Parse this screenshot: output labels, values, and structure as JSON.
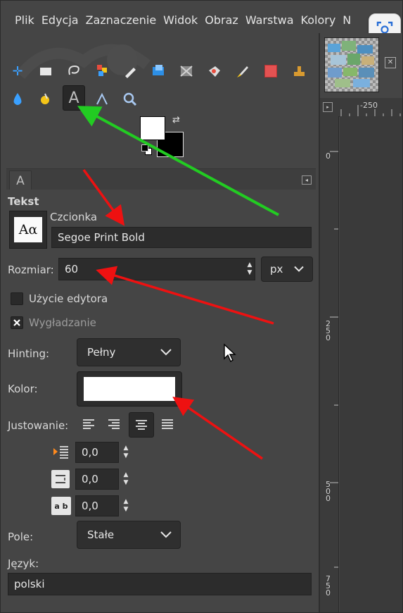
{
  "menubar": {
    "items": [
      "Plik",
      "Edycja",
      "Zaznaczenie",
      "Widok",
      "Obraz",
      "Warstwa",
      "Kolory",
      "N"
    ]
  },
  "toolbox": {
    "active_tool": "text-tool",
    "tools_row1": [
      "move-icon",
      "rect-select-icon",
      "lasso-icon",
      "fuzzy-select-icon",
      "pen-icon",
      "crop-icon",
      "transform-icon",
      "warp-icon",
      "paintbrush-icon",
      "eraser-icon",
      "clone-icon"
    ],
    "tools_row2": [
      "dodge-burn-icon",
      "paths-icon",
      "text-icon",
      "measure-icon",
      "zoom-icon"
    ]
  },
  "colors": {
    "foreground": "#ffffff",
    "background": "#000000"
  },
  "tool_options": {
    "title": "Tekst",
    "font_label": "Czcionka",
    "font_preview": "Aα",
    "font_value": "Segoe Print Bold",
    "size_label": "Rozmiar:",
    "size_value": "60",
    "size_unit": "px",
    "use_editor_label": "Użycie edytora",
    "antialias_label": "Wygładzanie",
    "hinting_label": "Hinting:",
    "hinting_value": "Pełny",
    "color_label": "Kolor:",
    "color_value": "#ffffff",
    "justify_label": "Justowanie:",
    "indent_value": "0,0",
    "line_spacing_value": "0,0",
    "letter_spacing_value": "0,0",
    "letter_spacing_icon_text": "a b",
    "box_label": "Pole:",
    "box_value": "Stałe",
    "language_label": "Język:",
    "language_value": "polski"
  },
  "canvas": {
    "hruler_labels": [
      "-250"
    ],
    "vruler_labels": [
      "0",
      "250",
      "500",
      "750"
    ]
  },
  "annotations": {
    "colors": {
      "green": "#22cc22",
      "red": "#ee1111"
    }
  }
}
